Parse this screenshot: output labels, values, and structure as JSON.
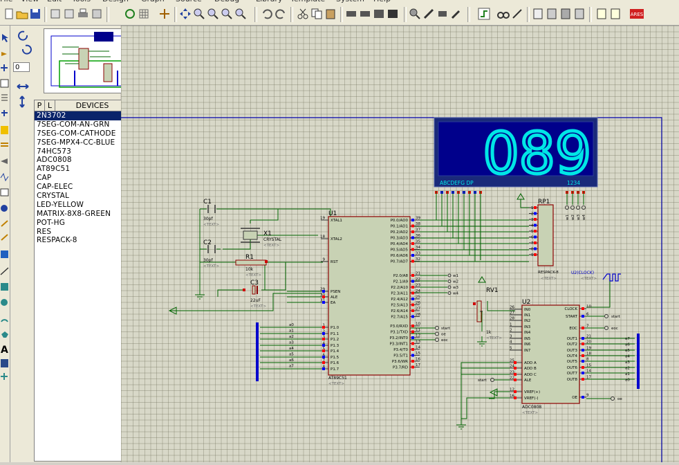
{
  "menu": [
    "File",
    "View",
    "Edit",
    "Tools",
    "Design",
    "Graph",
    "Source",
    "Debug",
    "Library",
    "Template",
    "System",
    "Help"
  ],
  "left_panel": {
    "tab_p": "P",
    "tab_l": "L",
    "devices_title": "DEVICES",
    "angle_value": "0",
    "devices": [
      "2N3702",
      "7SEG-COM-AN-GRN",
      "7SEG-COM-CATHODE",
      "7SEG-MPX4-CC-BLUE",
      "74HC573",
      "ADC0808",
      "AT89C51",
      "CAP",
      "CAP-ELEC",
      "CRYSTAL",
      "LED-YELLOW",
      "MATRIX-8X8-GREEN",
      "POT-HG",
      "RES",
      "RESPACK-8"
    ],
    "selected_device": "2N3702"
  },
  "display": {
    "digits": "089",
    "seg_label": "ABCDEFG  DP",
    "com_label": "1234"
  },
  "u1": {
    "ref": "U1",
    "part": "AT89C51",
    "text": "<TEXT>",
    "left_pins": [
      {
        "num": "19",
        "name": "XTAL1"
      },
      {
        "num": "18",
        "name": "XTAL2"
      },
      {
        "num": "9",
        "name": "RST"
      },
      {
        "num": "29",
        "name": "PSEN"
      },
      {
        "num": "30",
        "name": "ALE"
      },
      {
        "num": "31",
        "name": "EA"
      },
      {
        "num": "1",
        "name": "P1.0"
      },
      {
        "num": "2",
        "name": "P1.1"
      },
      {
        "num": "3",
        "name": "P1.2"
      },
      {
        "num": "4",
        "name": "P1.3"
      },
      {
        "num": "5",
        "name": "P1.4"
      },
      {
        "num": "6",
        "name": "P1.5"
      },
      {
        "num": "7",
        "name": "P1.6"
      },
      {
        "num": "8",
        "name": "P1.7"
      }
    ],
    "right_pins": [
      {
        "num": "39",
        "name": "P0.0/AD0"
      },
      {
        "num": "38",
        "name": "P0.1/AD1"
      },
      {
        "num": "37",
        "name": "P0.2/AD2"
      },
      {
        "num": "36",
        "name": "P0.3/AD3"
      },
      {
        "num": "35",
        "name": "P0.4/AD4"
      },
      {
        "num": "34",
        "name": "P0.5/AD5"
      },
      {
        "num": "33",
        "name": "P0.6/AD6"
      },
      {
        "num": "32",
        "name": "P0.7/AD7"
      },
      {
        "num": "21",
        "name": "P2.0/A8"
      },
      {
        "num": "22",
        "name": "P2.1/A9"
      },
      {
        "num": "23",
        "name": "P2.2/A10"
      },
      {
        "num": "24",
        "name": "P2.3/A11"
      },
      {
        "num": "25",
        "name": "P2.4/A12"
      },
      {
        "num": "26",
        "name": "P2.5/A13"
      },
      {
        "num": "27",
        "name": "P2.6/A14"
      },
      {
        "num": "28",
        "name": "P2.7/A15"
      },
      {
        "num": "10",
        "name": "P3.0/RXD"
      },
      {
        "num": "11",
        "name": "P3.1/TXD"
      },
      {
        "num": "12",
        "name": "P3.2/INT0"
      },
      {
        "num": "13",
        "name": "P3.3/INT1"
      },
      {
        "num": "14",
        "name": "P3.4/T0"
      },
      {
        "num": "15",
        "name": "P3.5/T1"
      },
      {
        "num": "16",
        "name": "P3.6/WR"
      },
      {
        "num": "17",
        "name": "P3.7/RD"
      }
    ],
    "p1_labels": [
      "a0",
      "a1",
      "a2",
      "a3",
      "a4",
      "a5",
      "a6",
      "a7"
    ],
    "p2_labels": [
      "w1",
      "w2",
      "w3",
      "w4"
    ],
    "p3_labels": [
      "start",
      "oe",
      "eoc"
    ]
  },
  "u2": {
    "ref": "U2",
    "part": "ADC0808",
    "text": "<TEXT>",
    "left_pins": [
      {
        "num": "26",
        "name": "IN0"
      },
      {
        "num": "27",
        "name": "IN1"
      },
      {
        "num": "28",
        "name": "IN2"
      },
      {
        "num": "1",
        "name": "IN3"
      },
      {
        "num": "2",
        "name": "IN4"
      },
      {
        "num": "3",
        "name": "IN5"
      },
      {
        "num": "4",
        "name": "IN6"
      },
      {
        "num": "5",
        "name": "IN7"
      },
      {
        "num": "25",
        "name": "ADD A"
      },
      {
        "num": "24",
        "name": "ADD B"
      },
      {
        "num": "23",
        "name": "ADD C"
      },
      {
        "num": "22",
        "name": "ALE"
      },
      {
        "num": "12",
        "name": "VREF(+)"
      },
      {
        "num": "16",
        "name": "VREF(-)"
      }
    ],
    "right_pins": [
      {
        "num": "10",
        "name": "CLOCK"
      },
      {
        "num": "6",
        "name": "START"
      },
      {
        "num": "7",
        "name": "EOC"
      },
      {
        "num": "21",
        "name": "OUT1"
      },
      {
        "num": "20",
        "name": "OUT2"
      },
      {
        "num": "19",
        "name": "OUT3"
      },
      {
        "num": "18",
        "name": "OUT4"
      },
      {
        "num": "8",
        "name": "OUT5"
      },
      {
        "num": "15",
        "name": "OUT6"
      },
      {
        "num": "14",
        "name": "OUT7"
      },
      {
        "num": "17",
        "name": "OUT8"
      },
      {
        "num": "9",
        "name": "OE"
      }
    ],
    "out_labels": [
      "a7",
      "a6",
      "a5",
      "a4",
      "a3",
      "a2",
      "a1",
      "a0"
    ],
    "start_label": "start",
    "eoc_label": "eoc",
    "oe_label": "oe",
    "clock_label": "U2(CLOCK)",
    "clock_text": "<TEXT>"
  },
  "rp1": {
    "ref": "RP1",
    "part": "RESPACK-8",
    "text": "<TEXT>",
    "pins": [
      "1",
      "2",
      "3",
      "4",
      "5",
      "6",
      "7",
      "8",
      "9"
    ],
    "w_labels": [
      "w1",
      "w2",
      "w3",
      "w4"
    ]
  },
  "c1": {
    "ref": "C1",
    "value": "30pf",
    "text": "<TEXT>"
  },
  "c2": {
    "ref": "C2",
    "value": "30pf",
    "text": "<TEXT>"
  },
  "c3": {
    "ref": "C3",
    "value": "22uF",
    "text": "<TEXT>"
  },
  "x1": {
    "ref": "X1",
    "part": "CRYSTAL",
    "text": "<TEXT>"
  },
  "r1": {
    "ref": "R1",
    "value": "10k",
    "text": "<TEXT>"
  },
  "rv1": {
    "ref": "RV1",
    "value": "1k",
    "text": "<TEXT>"
  },
  "colors": {
    "wire": "#006400",
    "chip_border": "#8b0000",
    "chip_fill": "#c8d2b4",
    "display_bg": "#00008b",
    "segment": "#00e6e6",
    "sheet_border": "#0000aa",
    "bus": "#0000cc"
  }
}
